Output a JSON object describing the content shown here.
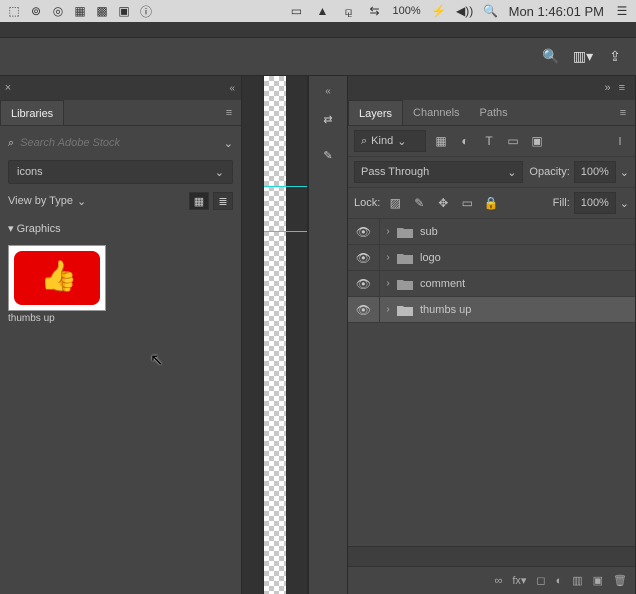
{
  "menubar": {
    "battery": "100%",
    "time": "Mon 1:46:01 PM"
  },
  "libraries": {
    "tab_label": "Libraries",
    "search_placeholder": "Search Adobe Stock",
    "library_name": "icons",
    "view_label": "View by Type",
    "section_label": "Graphics",
    "asset_name": "thumbs up"
  },
  "layers_panel": {
    "tabs": {
      "layers": "Layers",
      "channels": "Channels",
      "paths": "Paths"
    },
    "kind_label": "Kind",
    "blend_mode": "Pass Through",
    "opacity_label": "Opacity:",
    "opacity_value": "100%",
    "lock_label": "Lock:",
    "fill_label": "Fill:",
    "fill_value": "100%",
    "layers": [
      {
        "name": "sub"
      },
      {
        "name": "logo"
      },
      {
        "name": "comment"
      },
      {
        "name": "thumbs up"
      }
    ]
  }
}
